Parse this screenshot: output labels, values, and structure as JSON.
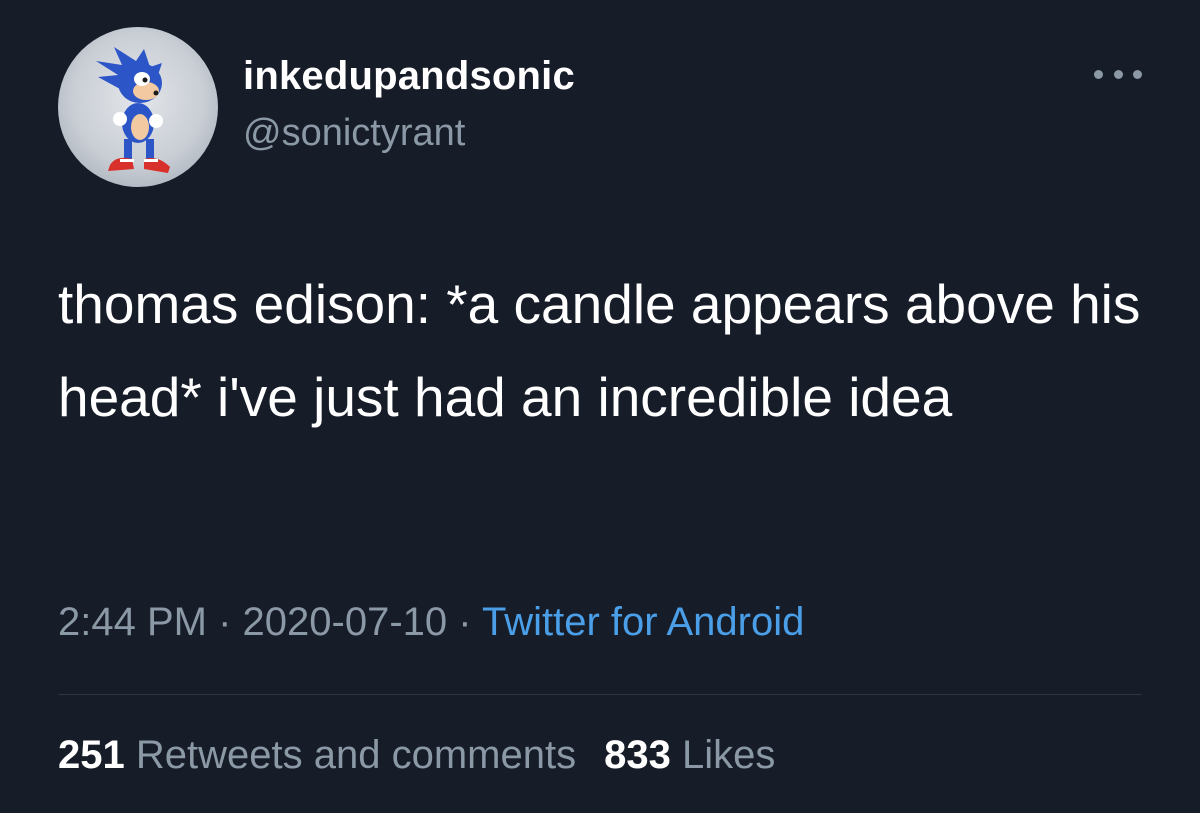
{
  "author": {
    "display_name": "inkedupandsonic",
    "handle": "@sonictyrant",
    "avatar_icon": "sonic-avatar-icon"
  },
  "menu": {
    "icon": "more-dots-icon"
  },
  "tweet": {
    "text": "thomas edison: *a candle appears above his head* i've just had an incredible idea"
  },
  "meta": {
    "time": "2:44 PM",
    "separator": "·",
    "date": "2020-07-10",
    "source": "Twitter for Android"
  },
  "stats": {
    "retweets_count": "251",
    "retweets_label": "Retweets and comments",
    "likes_count": "833",
    "likes_label": "Likes"
  },
  "colors": {
    "background": "#161c28",
    "secondary_text": "#8b98a5",
    "link": "#4a9fe8",
    "divider": "#2f3640"
  }
}
